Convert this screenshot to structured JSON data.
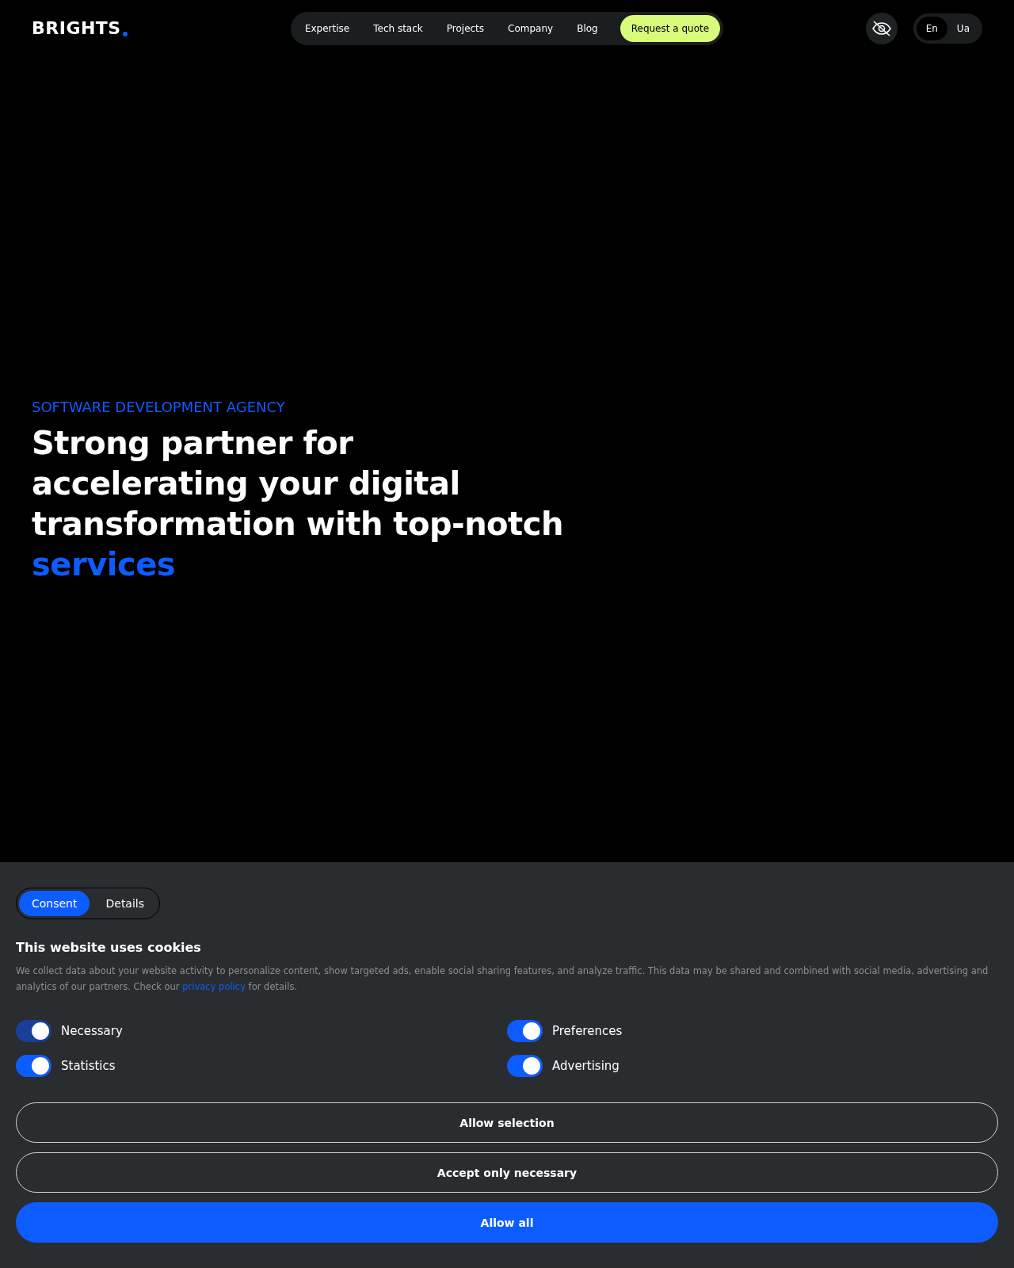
{
  "header": {
    "logo": "BRIGHTS",
    "nav": [
      {
        "label": "Expertise",
        "kind": "link"
      },
      {
        "label": "Tech stack",
        "kind": "link"
      },
      {
        "label": "Projects",
        "kind": "link"
      },
      {
        "label": "Company",
        "kind": "link"
      },
      {
        "label": "Blog",
        "kind": "link"
      },
      {
        "label": "Request a quote",
        "kind": "cta"
      }
    ],
    "languages": [
      {
        "label": "En",
        "selected": true
      },
      {
        "label": "Ua",
        "selected": false
      }
    ]
  },
  "hero": {
    "eyebrow": "SOFTWARE DEVELOPMENT AGENCY",
    "headline": "Strong partner for accelerating your digital transformation with top-notch",
    "highlight": "services"
  },
  "cookie_banner": {
    "tabs": [
      {
        "label": "Consent",
        "selected": true
      },
      {
        "label": "Details",
        "selected": false
      }
    ],
    "title": "This website uses cookies",
    "text_before": "We collect data about your website activity to personalize content, show targeted ads, enable social sharing features, and analyze traffic. This data may be shared and combined with social media, advertising and analytics of our partners. Check our",
    "link": "privacy policy",
    "text_after": "for details.",
    "toggles": [
      {
        "label": "Necessary",
        "on": true,
        "disabled": true
      },
      {
        "label": "Preferences",
        "on": true,
        "disabled": false
      },
      {
        "label": "Statistics",
        "on": true,
        "disabled": false
      },
      {
        "label": "Advertising",
        "on": true,
        "disabled": false
      }
    ],
    "buttons": [
      {
        "label": "Allow selection",
        "kind": "outline"
      },
      {
        "label": "Accept only necessary",
        "kind": "outline"
      },
      {
        "label": "Allow all",
        "kind": "primary"
      }
    ]
  }
}
